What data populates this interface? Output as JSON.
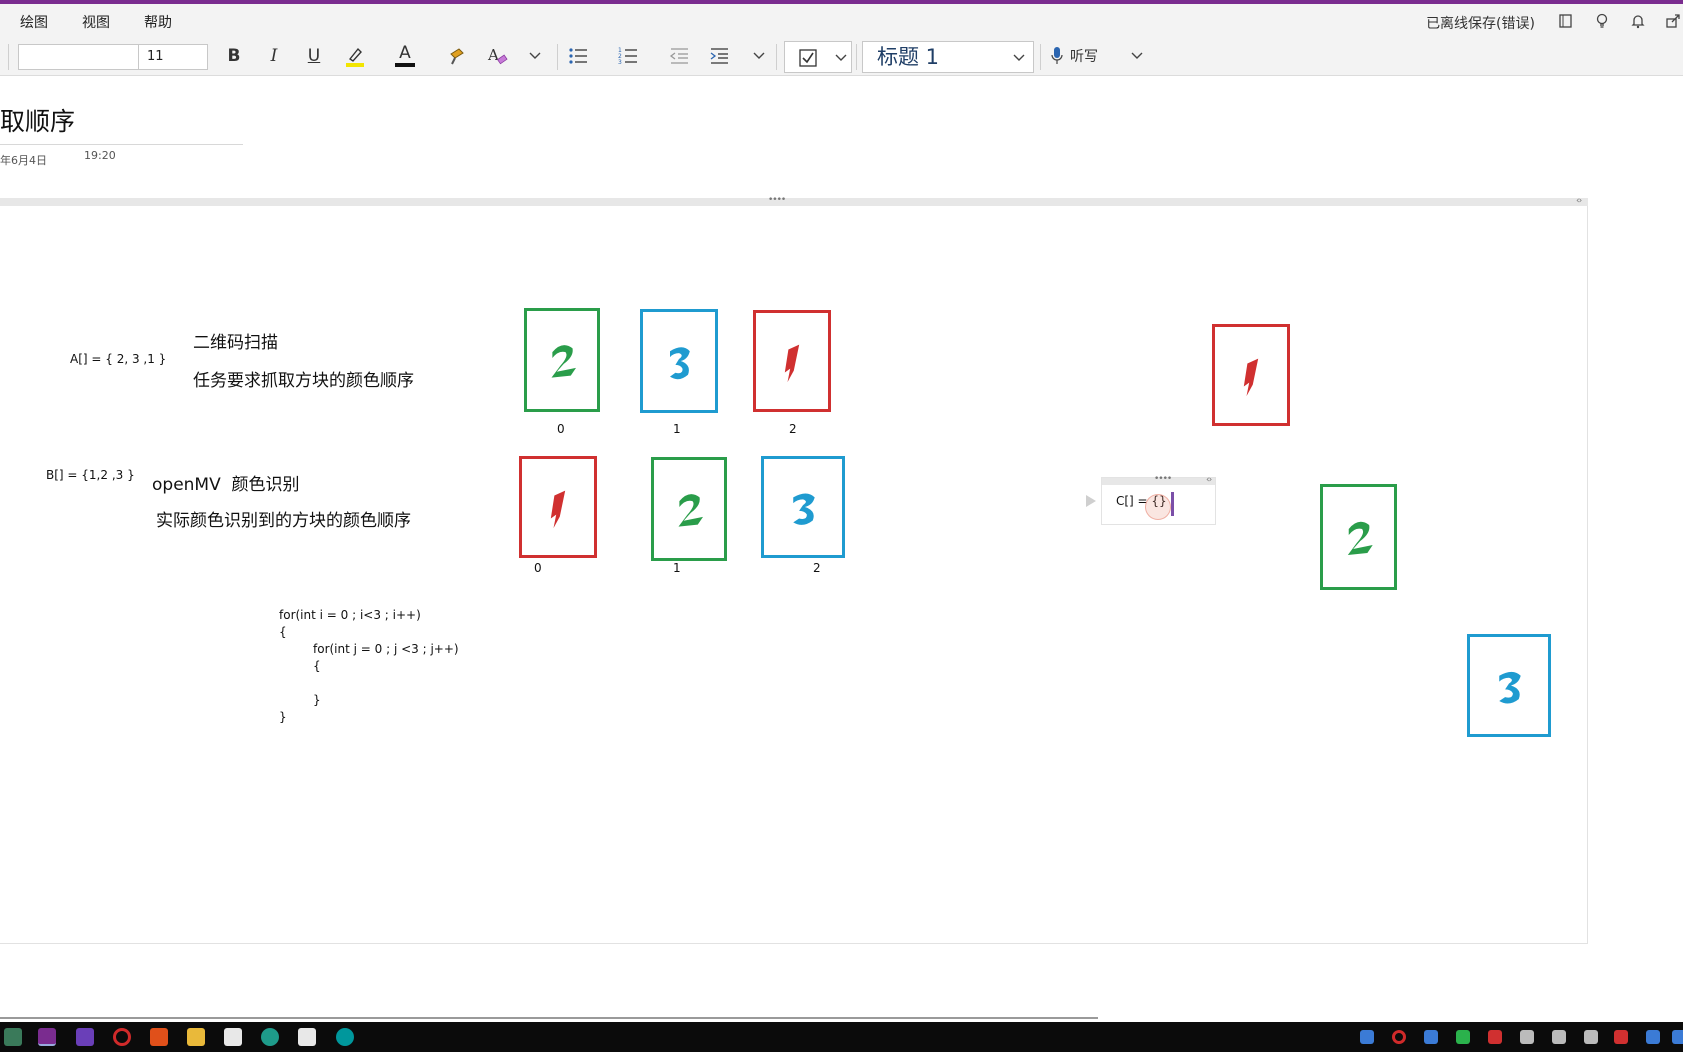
{
  "menu": {
    "items": [
      "绘图",
      "视图",
      "帮助"
    ]
  },
  "status": {
    "save_state": "已离线保存(错误)"
  },
  "toolbar": {
    "font_name_value": "",
    "font_size_value": "11",
    "bold": "B",
    "italic": "I",
    "underline": "U",
    "font_color_glyph": "A",
    "style_value": "标题 1",
    "dictate_label": "听写"
  },
  "page": {
    "title": "取顺序",
    "date": "年6月4日",
    "time": "19:20"
  },
  "notes": {
    "a_array": "A[] = { 2, 3 ,1 }",
    "qr_title": "二维码扫描",
    "qr_desc": "任务要求抓取方块的颜色顺序",
    "b_array": "B[] = {1,2 ,3 }",
    "mv_title": "openMV  颜色识别",
    "mv_desc": "实际颜色识别到的方块的颜色顺序",
    "code_lines": [
      "for(int i = 0 ; i<3 ; i++)",
      "{",
      "for(int j = 0 ; j <3 ; j++)",
      "{",
      "",
      "}",
      "}"
    ],
    "c_array": "C[] = {}"
  },
  "cards": {
    "row1": [
      {
        "digit": "2",
        "color": "#2a9d4a",
        "index": "0"
      },
      {
        "digit": "3",
        "color": "#1f9bd0",
        "index": "1"
      },
      {
        "digit": "1",
        "color": "#d03030",
        "index": "2"
      }
    ],
    "row2": [
      {
        "digit": "1",
        "color": "#d03030",
        "index": "0"
      },
      {
        "digit": "2",
        "color": "#2a9d4a",
        "index": "1"
      },
      {
        "digit": "3",
        "color": "#1f9bd0",
        "index": "2"
      }
    ],
    "loose": [
      {
        "digit": "1",
        "color": "#d03030"
      },
      {
        "digit": "2",
        "color": "#2a9d4a"
      },
      {
        "digit": "3",
        "color": "#1f9bd0"
      }
    ]
  },
  "colors": {
    "accent_purple": "#7a2c8f",
    "red": "#d03030",
    "green": "#2a9d4a",
    "blue": "#1f9bd0"
  },
  "taskbar": {
    "apps": [
      "calculator-icon",
      "onenote-icon",
      "visual-studio-icon",
      "record-icon",
      "tool-icon",
      "file-explorer-icon",
      "window-icon",
      "edge-icon",
      "window2-icon",
      "arduino-icon"
    ]
  }
}
